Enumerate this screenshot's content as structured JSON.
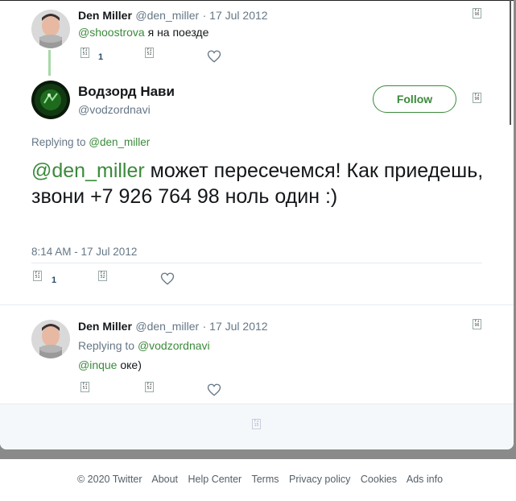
{
  "tweet1": {
    "name": "Den Miller",
    "handle": "@den_miller",
    "date": "· 17 Jul 2012",
    "mention": "@shoostrova",
    "text": " я на поезде",
    "reply_count": "1"
  },
  "main_tweet": {
    "name": "Водзорд Нави",
    "handle": "@vodzordnavi",
    "follow_label": "Follow",
    "replying_to_label": "Replying to ",
    "replying_to_user": "@den_miller",
    "mention": "@den_miller",
    "text": " может пересечемся! Как приедешь, звони +7 926 764 98 ноль один :)",
    "timestamp": "8:14 AM - 17 Jul 2012",
    "reply_count": "1"
  },
  "tweet3": {
    "name": "Den Miller",
    "handle": "@den_miller",
    "date": "· 17 Jul 2012",
    "replying_to_label": "Replying to ",
    "replying_to_user": "@vodzordnavi",
    "mention": "@inque",
    "text": " оке)"
  },
  "footer": {
    "copyright": "© 2020 Twitter",
    "about": "About",
    "help": "Help Center",
    "terms": "Terms",
    "privacy": "Privacy policy",
    "cookies": "Cookies",
    "ads": "Ads info"
  },
  "icons": {
    "reply": "reply-icon",
    "retweet": "retweet-icon",
    "like": "heart-icon",
    "more": "caret-down-icon",
    "accent": "#3b8a3b"
  }
}
